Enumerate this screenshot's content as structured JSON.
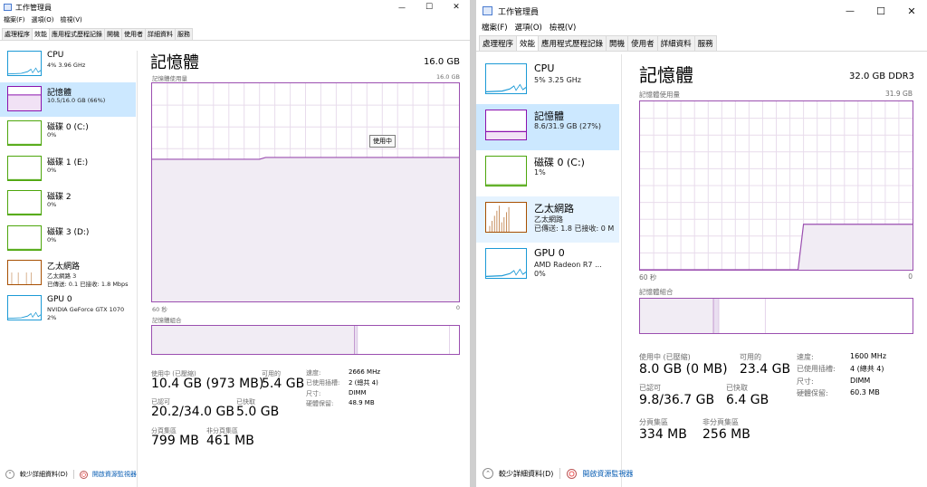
{
  "w1": {
    "title": "工作管理員",
    "controls": {
      "minimize": "—",
      "maximize": "☐",
      "close": "✕"
    },
    "menu": [
      "檔案(F)",
      "選項(O)",
      "檢視(V)"
    ],
    "tabs": [
      "處理程序",
      "效能",
      "應用程式歷程記錄",
      "開機",
      "使用者",
      "詳細資料",
      "服務"
    ],
    "active_tab": 1,
    "sidebar": [
      {
        "name": "CPU",
        "sub": [
          "4%  3.96 GHz"
        ],
        "color": "#1c9ad6",
        "fill": 0.05
      },
      {
        "name": "記憶體",
        "sub": [
          "10.5/16.0 GB (66%)"
        ],
        "color": "#8b12ae",
        "fill": 0.66
      },
      {
        "name": "磁碟 0 (C:)",
        "sub": [
          "0%"
        ],
        "color": "#4da60c",
        "fill": 0.0
      },
      {
        "name": "磁碟 1 (E:)",
        "sub": [
          "0%"
        ],
        "color": "#4da60c",
        "fill": 0.0
      },
      {
        "name": "磁碟 2",
        "sub": [
          "0%"
        ],
        "color": "#4da60c",
        "fill": 0.0
      },
      {
        "name": "磁碟 3 (D:)",
        "sub": [
          "0%"
        ],
        "color": "#4da60c",
        "fill": 0.0
      },
      {
        "name": "乙太網路",
        "sub": [
          "乙太網路 3",
          "已傳送: 0.1  已接收: 1.8 Mbps"
        ],
        "color": "#a74f01",
        "fill": 0.2
      },
      {
        "name": "GPU 0",
        "sub": [
          "NVIDIA GeForce GTX 1070",
          "2%"
        ],
        "color": "#1c9ad6",
        "fill": 0.02
      }
    ],
    "selected": 1,
    "main": {
      "title": "記憶體",
      "right": "16.0 GB",
      "usage_label": "記憶體使用量",
      "usage_max": "16.0 GB",
      "usage_level": 0.66,
      "tooltip": "使用中",
      "time_left": "60 秒",
      "time_right": "0",
      "composition_label": "記憶體組合",
      "stats": {
        "in_use_label": "使用中 (已壓縮)",
        "in_use": "10.4 GB (973 MB)",
        "available_label": "可用的",
        "available": "5.4 GB",
        "committed_label": "已認可",
        "committed": "20.2/34.0 GB",
        "cached_label": "已快取",
        "cached": "5.0 GB",
        "paged_label": "分頁集區",
        "paged": "799 MB",
        "nonpaged_label": "非分頁集區",
        "nonpaged": "461 MB"
      },
      "specs": [
        {
          "label": "速度:",
          "value": "2666 MHz"
        },
        {
          "label": "已使用插槽:",
          "value": "2 (總共 4)"
        },
        {
          "label": "尺寸:",
          "value": "DIMM"
        },
        {
          "label": "硬體保留:",
          "value": "48.9 MB"
        }
      ]
    },
    "footer": {
      "fewer_details": "較少詳細資料(D)",
      "resource_monitor": "開啟資源監視器"
    }
  },
  "w2": {
    "title": "工作管理員",
    "controls": {
      "minimize": "—",
      "maximize": "☐",
      "close": "✕"
    },
    "menu": [
      "檔案(F)",
      "選項(O)",
      "檢視(V)"
    ],
    "tabs": [
      "處理程序",
      "效能",
      "應用程式歷程記錄",
      "開機",
      "使用者",
      "詳細資料",
      "服務"
    ],
    "active_tab": 1,
    "sidebar": [
      {
        "name": "CPU",
        "sub": [
          "5%  3.25 GHz"
        ],
        "color": "#1c9ad6",
        "fill": 0.05
      },
      {
        "name": "記憶體",
        "sub": [
          "8.6/31.9 GB (27%)"
        ],
        "color": "#8b12ae",
        "fill": 0.27
      },
      {
        "name": "磁碟 0 (C:)",
        "sub": [
          "1%"
        ],
        "color": "#4da60c",
        "fill": 0.01
      },
      {
        "name": "乙太網路",
        "sub": [
          "乙太網路",
          "已傳送: 1.8  已接收: 0 M"
        ],
        "color": "#a74f01",
        "fill": 0.9
      },
      {
        "name": "GPU 0",
        "sub": [
          "AMD Radeon R7 ...",
          "0%"
        ],
        "color": "#1c9ad6",
        "fill": 0.0
      }
    ],
    "selected": 1,
    "hovered": 3,
    "main": {
      "title": "記憶體",
      "right": "32.0 GB DDR3",
      "usage_label": "記憶體使用量",
      "usage_max": "31.9 GB",
      "usage_level": 0.27,
      "time_left": "60 秒",
      "time_right": "0",
      "composition_label": "記憶體組合",
      "stats": {
        "in_use_label": "使用中 (已壓縮)",
        "in_use": "8.0 GB (0 MB)",
        "available_label": "可用的",
        "available": "23.4 GB",
        "committed_label": "已認可",
        "committed": "9.8/36.7 GB",
        "cached_label": "已快取",
        "cached": "6.4 GB",
        "paged_label": "分頁集區",
        "paged": "334 MB",
        "nonpaged_label": "非分頁集區",
        "nonpaged": "256 MB"
      },
      "specs": [
        {
          "label": "速度:",
          "value": "1600 MHz"
        },
        {
          "label": "已使用插槽:",
          "value": "4 (總共 4)"
        },
        {
          "label": "尺寸:",
          "value": "DIMM"
        },
        {
          "label": "硬體保留:",
          "value": "60.3 MB"
        }
      ]
    },
    "footer": {
      "fewer_details": "較少詳細資料(D)",
      "resource_monitor": "開啟資源監視器"
    }
  }
}
